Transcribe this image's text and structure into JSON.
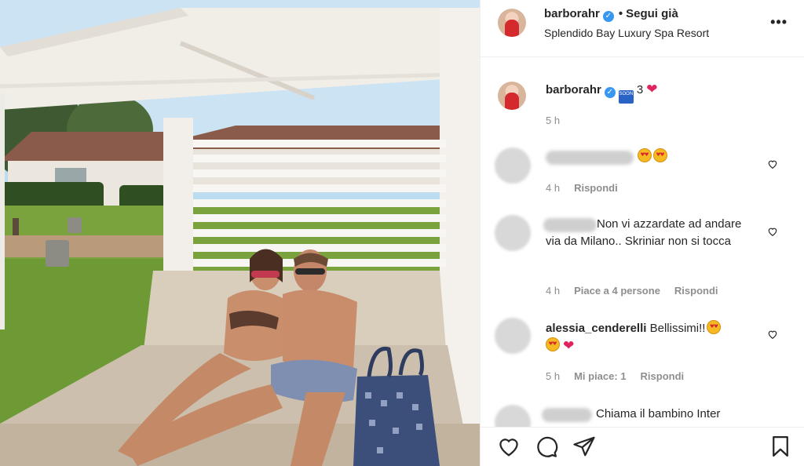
{
  "header": {
    "username": "barborahr",
    "verified_mark": "✓",
    "separator": "•",
    "follow_label": "Segui già",
    "location": "Splendido Bay Luxury Spa Resort",
    "more_label": "•••"
  },
  "caption": {
    "username": "barborahr",
    "soon_label": "SOON",
    "count": "3",
    "heart": "❤",
    "time": "5 h"
  },
  "comments": [
    {
      "time": "4 h",
      "reply_label": "Rispondi"
    },
    {
      "text": "Non vi azzardate ad andare via da Milano.. Skriniar non si tocca",
      "time": "4 h",
      "likes_label": "Piace a 4 persone",
      "reply_label": "Rispondi"
    },
    {
      "username": "alessia_cenderelli",
      "text": "Bellissimi!!",
      "time": "5 h",
      "likes_label": "Mi piace: 1",
      "reply_label": "Rispondi"
    },
    {
      "text": "Chiama il bambino Inter"
    }
  ],
  "icons": {
    "like": "heart-icon",
    "comment": "comment-icon",
    "share": "paper-plane-icon",
    "save": "bookmark-icon"
  },
  "colors": {
    "verified_blue": "#3897f0",
    "heart_red": "#e0245e",
    "muted_text": "#8e8e8e"
  }
}
